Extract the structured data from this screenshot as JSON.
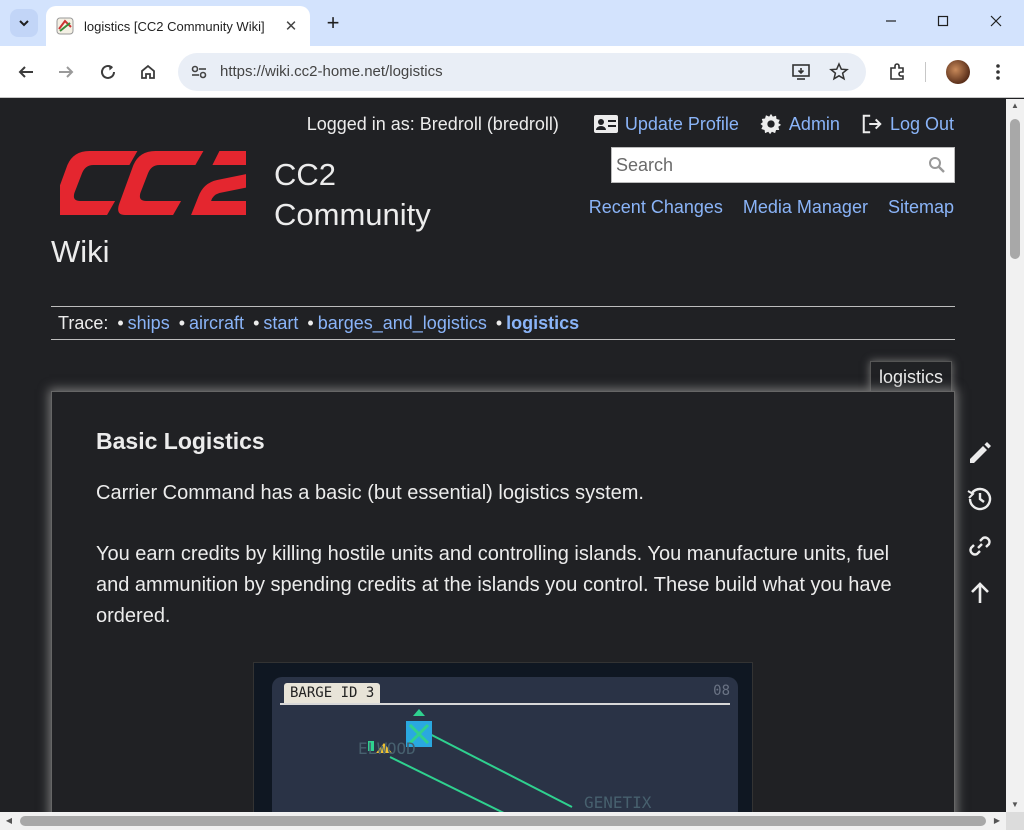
{
  "browser": {
    "tab_title": "logistics [CC2 Community Wiki]",
    "url": "https://wiki.cc2-home.net/logistics",
    "new_tab": "+",
    "tab_close": "✕"
  },
  "user": {
    "logged_in_text": "Logged in as: Bredroll (bredroll)",
    "update_profile": "Update Profile",
    "admin": "Admin",
    "log_out": "Log Out"
  },
  "site": {
    "logo_text": "CC2",
    "title_line1": "CC2",
    "title_line2": "Community",
    "title_line3": "Wiki",
    "brand_color": "#e4262f",
    "link_color": "#8ab4f8"
  },
  "search": {
    "placeholder": "Search"
  },
  "site_tools": [
    "Recent Changes",
    "Media Manager",
    "Sitemap"
  ],
  "trace": {
    "label": "Trace:",
    "items": [
      "ships",
      "aircraft",
      "start",
      "barges_and_logistics",
      "logistics"
    ]
  },
  "page": {
    "name_tab": "logistics",
    "heading": "Basic Logistics",
    "paragraph1": "Carrier Command has a basic (but essential) logistics system.",
    "paragraph2": "You earn credits by killing hostile units and controlling islands. You manufacture units, fuel and ammunition by spending credits at the islands you control. These build what you have ordered."
  },
  "screenshot": {
    "label": "BARGE ID 3",
    "number": "08",
    "island1": "ELWOOD",
    "island2": "GENETIX"
  },
  "page_tools": [
    "edit-icon",
    "history-icon",
    "link-icon",
    "back-to-top-icon"
  ]
}
